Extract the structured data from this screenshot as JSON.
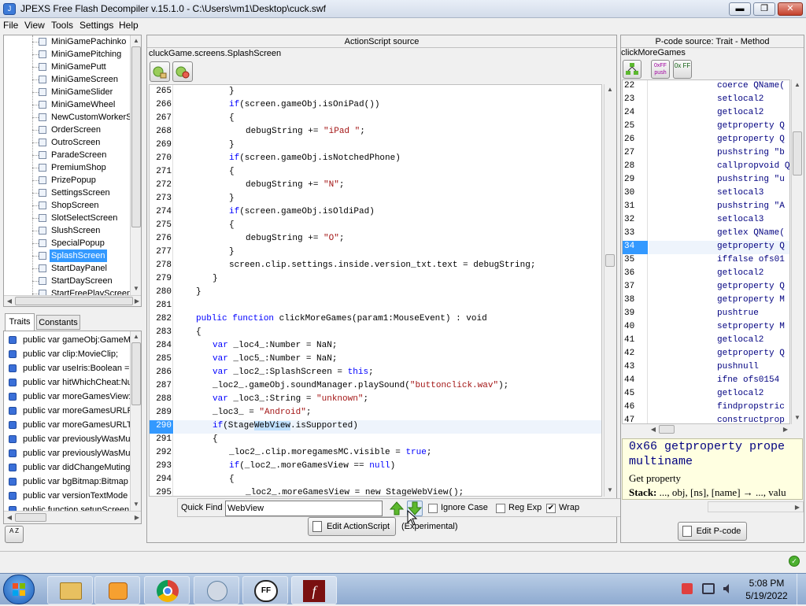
{
  "window": {
    "title": "JPEXS Free Flash Decompiler v.15.1.0 - C:\\Users\\vm1\\Desktop\\cuck.swf",
    "minimize_label": "▬",
    "maximize_label": "❐",
    "close_label": "✕"
  },
  "menu": [
    "File",
    "View",
    "Tools",
    "Settings",
    "Help"
  ],
  "tree": {
    "items": [
      "MiniGamePachinko",
      "MiniGamePitching",
      "MiniGamePutt",
      "MiniGameScreen",
      "MiniGameSlider",
      "MiniGameWheel",
      "NewCustomWorkerSc",
      "OrderScreen",
      "OutroScreen",
      "ParadeScreen",
      "PremiumShop",
      "PrizePopup",
      "SettingsScreen",
      "ShopScreen",
      "SlotSelectScreen",
      "SlushScreen",
      "SpecialPopup",
      "SplashScreen",
      "StartDayPanel",
      "StartDayScreen",
      "StartFreePlayScreen"
    ],
    "selected_index": 17
  },
  "traits_tabs": [
    "Traits",
    "Constants"
  ],
  "traits": [
    "public var gameObj:GameMo",
    "public var clip:MovieClip;",
    "public var useIris:Boolean =",
    "public var hitWhichCheat:Nu",
    "public var moreGamesView:S",
    "public var moreGamesURLPh",
    "public var moreGamesURLTa",
    "public var previouslyWasMu",
    "public var previouslyWasMu",
    "public var didChangeMuting",
    "public var bgBitmap:Bitmap",
    "public var versionTextMode",
    "public function setupScreen"
  ],
  "sort_label": "A Z",
  "actionscript": {
    "header": "ActionScript source",
    "class_path": "cluckGame.screens.SplashScreen",
    "lines": [
      {
        "n": "265",
        "indent": 3,
        "parts": [
          {
            "t": "}",
            "c": ""
          }
        ]
      },
      {
        "n": "266",
        "indent": 3,
        "parts": [
          {
            "t": "if",
            "c": "kw"
          },
          {
            "t": "(screen.gameObj.isOniPad())",
            "c": ""
          }
        ]
      },
      {
        "n": "267",
        "indent": 3,
        "parts": [
          {
            "t": "{",
            "c": ""
          }
        ]
      },
      {
        "n": "268",
        "indent": 4,
        "parts": [
          {
            "t": "debugString += ",
            "c": ""
          },
          {
            "t": "\"iPad \"",
            "c": "st"
          },
          {
            "t": ";",
            "c": ""
          }
        ]
      },
      {
        "n": "269",
        "indent": 3,
        "parts": [
          {
            "t": "}",
            "c": ""
          }
        ]
      },
      {
        "n": "270",
        "indent": 3,
        "parts": [
          {
            "t": "if",
            "c": "kw"
          },
          {
            "t": "(screen.gameObj.isNotchedPhone)",
            "c": ""
          }
        ]
      },
      {
        "n": "271",
        "indent": 3,
        "parts": [
          {
            "t": "{",
            "c": ""
          }
        ]
      },
      {
        "n": "272",
        "indent": 4,
        "parts": [
          {
            "t": "debugString += ",
            "c": ""
          },
          {
            "t": "\"N\"",
            "c": "st"
          },
          {
            "t": ";",
            "c": ""
          }
        ]
      },
      {
        "n": "273",
        "indent": 3,
        "parts": [
          {
            "t": "}",
            "c": ""
          }
        ]
      },
      {
        "n": "274",
        "indent": 3,
        "parts": [
          {
            "t": "if",
            "c": "kw"
          },
          {
            "t": "(screen.gameObj.isOldiPad)",
            "c": ""
          }
        ]
      },
      {
        "n": "275",
        "indent": 3,
        "parts": [
          {
            "t": "{",
            "c": ""
          }
        ]
      },
      {
        "n": "276",
        "indent": 4,
        "parts": [
          {
            "t": "debugString += ",
            "c": ""
          },
          {
            "t": "\"O\"",
            "c": "st"
          },
          {
            "t": ";",
            "c": ""
          }
        ]
      },
      {
        "n": "277",
        "indent": 3,
        "parts": [
          {
            "t": "}",
            "c": ""
          }
        ]
      },
      {
        "n": "278",
        "indent": 3,
        "parts": [
          {
            "t": "screen.clip.settings.inside.version_txt.text = debugString;",
            "c": ""
          }
        ]
      },
      {
        "n": "279",
        "indent": 2,
        "parts": [
          {
            "t": "}",
            "c": ""
          }
        ]
      },
      {
        "n": "280",
        "indent": 1,
        "parts": [
          {
            "t": "}",
            "c": ""
          }
        ]
      },
      {
        "n": "281",
        "indent": 0,
        "parts": []
      },
      {
        "n": "282",
        "indent": 1,
        "parts": [
          {
            "t": "public function",
            "c": "kw"
          },
          {
            "t": " clickMoreGames(param1:MouseEvent) : void",
            "c": ""
          }
        ]
      },
      {
        "n": "283",
        "indent": 1,
        "parts": [
          {
            "t": "{",
            "c": ""
          }
        ]
      },
      {
        "n": "284",
        "indent": 2,
        "parts": [
          {
            "t": "var",
            "c": "kw"
          },
          {
            "t": " _loc4_:Number = NaN;",
            "c": ""
          }
        ]
      },
      {
        "n": "285",
        "indent": 2,
        "parts": [
          {
            "t": "var",
            "c": "kw"
          },
          {
            "t": " _loc5_:Number = NaN;",
            "c": ""
          }
        ]
      },
      {
        "n": "286",
        "indent": 2,
        "parts": [
          {
            "t": "var",
            "c": "kw"
          },
          {
            "t": " _loc2_:SplashScreen = ",
            "c": ""
          },
          {
            "t": "this",
            "c": "kw"
          },
          {
            "t": ";",
            "c": ""
          }
        ]
      },
      {
        "n": "287",
        "indent": 2,
        "parts": [
          {
            "t": "_loc2_.gameObj.soundManager.playSound(",
            "c": ""
          },
          {
            "t": "\"buttonclick.wav\"",
            "c": "st"
          },
          {
            "t": ");",
            "c": ""
          }
        ]
      },
      {
        "n": "288",
        "indent": 2,
        "parts": [
          {
            "t": "var",
            "c": "kw"
          },
          {
            "t": " _loc3_:String = ",
            "c": ""
          },
          {
            "t": "\"unknown\"",
            "c": "st"
          },
          {
            "t": ";",
            "c": ""
          }
        ]
      },
      {
        "n": "289",
        "indent": 2,
        "parts": [
          {
            "t": "_loc3_ = ",
            "c": ""
          },
          {
            "t": "\"Android\"",
            "c": "st"
          },
          {
            "t": ";",
            "c": ""
          }
        ]
      },
      {
        "n": "290",
        "indent": 2,
        "parts": [
          {
            "t": "if",
            "c": "kw"
          },
          {
            "t": "(Stage",
            "c": ""
          },
          {
            "t": "WebView",
            "c": "hl"
          },
          {
            "t": ".isSupported)",
            "c": ""
          }
        ],
        "current": true
      },
      {
        "n": "291",
        "indent": 2,
        "parts": [
          {
            "t": "{",
            "c": ""
          }
        ]
      },
      {
        "n": "292",
        "indent": 3,
        "parts": [
          {
            "t": "_loc2_.clip.moregamesMC.visible = ",
            "c": ""
          },
          {
            "t": "true",
            "c": "kw"
          },
          {
            "t": ";",
            "c": ""
          }
        ]
      },
      {
        "n": "293",
        "indent": 3,
        "parts": [
          {
            "t": "if",
            "c": "kw"
          },
          {
            "t": "(_loc2_.moreGamesView == ",
            "c": ""
          },
          {
            "t": "null",
            "c": "kw"
          },
          {
            "t": ")",
            "c": ""
          }
        ]
      },
      {
        "n": "294",
        "indent": 3,
        "parts": [
          {
            "t": "{",
            "c": ""
          }
        ]
      },
      {
        "n": "295",
        "indent": 4,
        "parts": [
          {
            "t": "_loc2_.moreGamesView = new StageWebView();",
            "c": ""
          }
        ]
      }
    ]
  },
  "quickfind": {
    "label": "Quick Find",
    "value": "WebView",
    "ignore_case_label": "Ignore Case",
    "regexp_label": "Reg Exp",
    "wrap_label": "Wrap",
    "ignore_case": false,
    "regexp": false,
    "wrap": true
  },
  "edit_actionscript_label": "Edit ActionScript",
  "experimental_label": "(Experimental)",
  "pcode": {
    "header": "P-code source: Trait - Method",
    "method": "clickMoreGames",
    "toolbar": [
      "graph-icon",
      "hex-push-icon",
      "hex-ff-icon"
    ],
    "toolbar_labels": [
      "",
      "0xFF push",
      "0x FF"
    ],
    "lines": [
      {
        "n": "22",
        "t": "coerce QName("
      },
      {
        "n": "23",
        "t": "setlocal2"
      },
      {
        "n": "24",
        "t": "getlocal2"
      },
      {
        "n": "25",
        "t": "getproperty Q"
      },
      {
        "n": "26",
        "t": "getproperty Q"
      },
      {
        "n": "27",
        "t": "pushstring \"b"
      },
      {
        "n": "28",
        "t": "callpropvoid Q"
      },
      {
        "n": "29",
        "t": "pushstring \"u"
      },
      {
        "n": "30",
        "t": "setlocal3"
      },
      {
        "n": "31",
        "t": "pushstring \"A"
      },
      {
        "n": "32",
        "t": "setlocal3"
      },
      {
        "n": "33",
        "t": "getlex QName("
      },
      {
        "n": "34",
        "t": "getproperty Q",
        "current": true
      },
      {
        "n": "35",
        "t": "iffalse ofs01"
      },
      {
        "n": "36",
        "t": "getlocal2"
      },
      {
        "n": "37",
        "t": "getproperty Q"
      },
      {
        "n": "38",
        "t": "getproperty M"
      },
      {
        "n": "39",
        "t": "pushtrue"
      },
      {
        "n": "40",
        "t": "setproperty M"
      },
      {
        "n": "41",
        "t": "getlocal2"
      },
      {
        "n": "42",
        "t": "getproperty Q"
      },
      {
        "n": "43",
        "t": "pushnull"
      },
      {
        "n": "44",
        "t": "ifne ofs0154"
      },
      {
        "n": "45",
        "t": "getlocal2"
      },
      {
        "n": "46",
        "t": "findpropstric"
      },
      {
        "n": "47",
        "t": "constructprop"
      }
    ],
    "doc_title": "0x66 getproperty prope",
    "doc_sub": "multiname",
    "doc_desc": "Get property",
    "doc_stack_label": "Stack:",
    "doc_stack": "..., obj, [ns], [name] → ..., valu",
    "edit_label": "Edit P-code"
  },
  "taskbar": {
    "time": "5:08 PM",
    "date": "5/19/2022"
  },
  "colors": {
    "accent": "#3399ff",
    "line_highlight": "#c8e0ff",
    "keyword": "#0000ff",
    "string": "#a31515"
  }
}
